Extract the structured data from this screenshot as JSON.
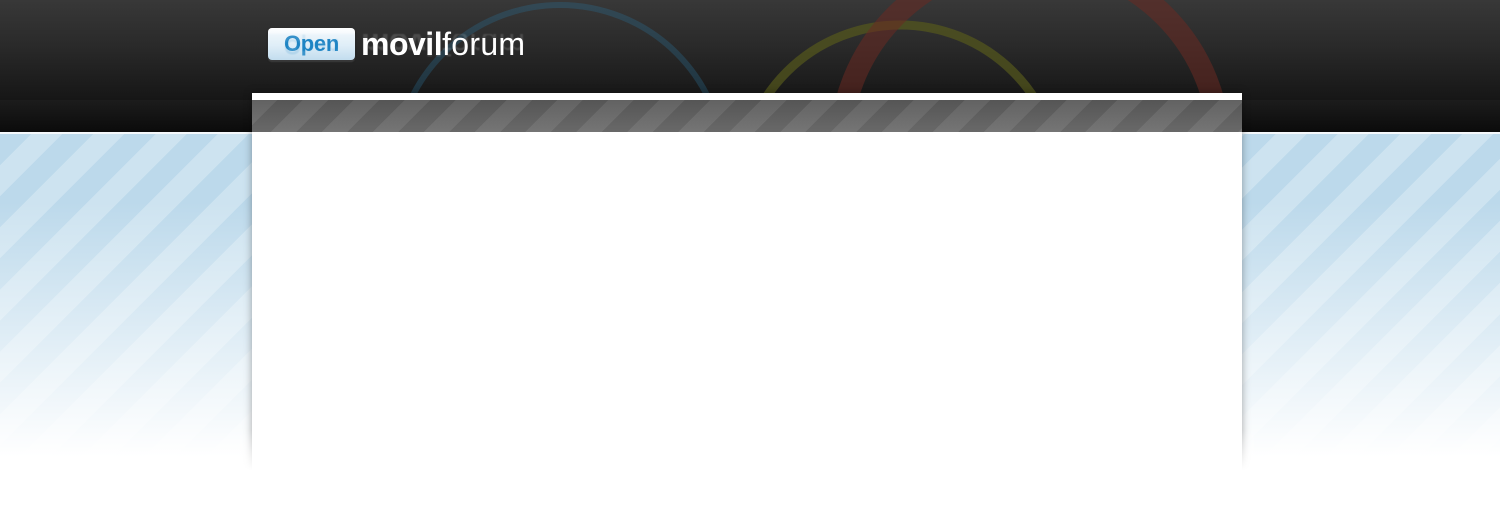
{
  "brand": {
    "badge_text": "Open",
    "name_bold": "movil",
    "name_light": "forum"
  },
  "colors": {
    "header_dark": "#2a2a2a",
    "nav_strip": "#111111",
    "badge_text": "#1d84c4",
    "stripe_light_blue": "#bcd9eb",
    "panel_bar": "#666666",
    "panel": "#ffffff"
  },
  "decor": {
    "header_rings": [
      "blue-ring",
      "olive-ring",
      "red-ring"
    ]
  }
}
